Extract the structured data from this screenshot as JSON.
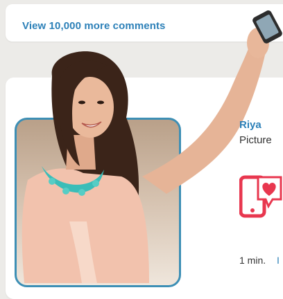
{
  "comments": {
    "link_text": "View 10,000 more comments"
  },
  "post": {
    "author": "Riya",
    "type_label": "Picture",
    "timestamp": "1 min.",
    "timestamp_suffix": "I"
  },
  "colors": {
    "accent": "#2c80b8",
    "frame": "#3d8fb5",
    "icon_red": "#e8374f",
    "background": "#ecebe8"
  },
  "icons": [
    "camera-heart-icon"
  ]
}
